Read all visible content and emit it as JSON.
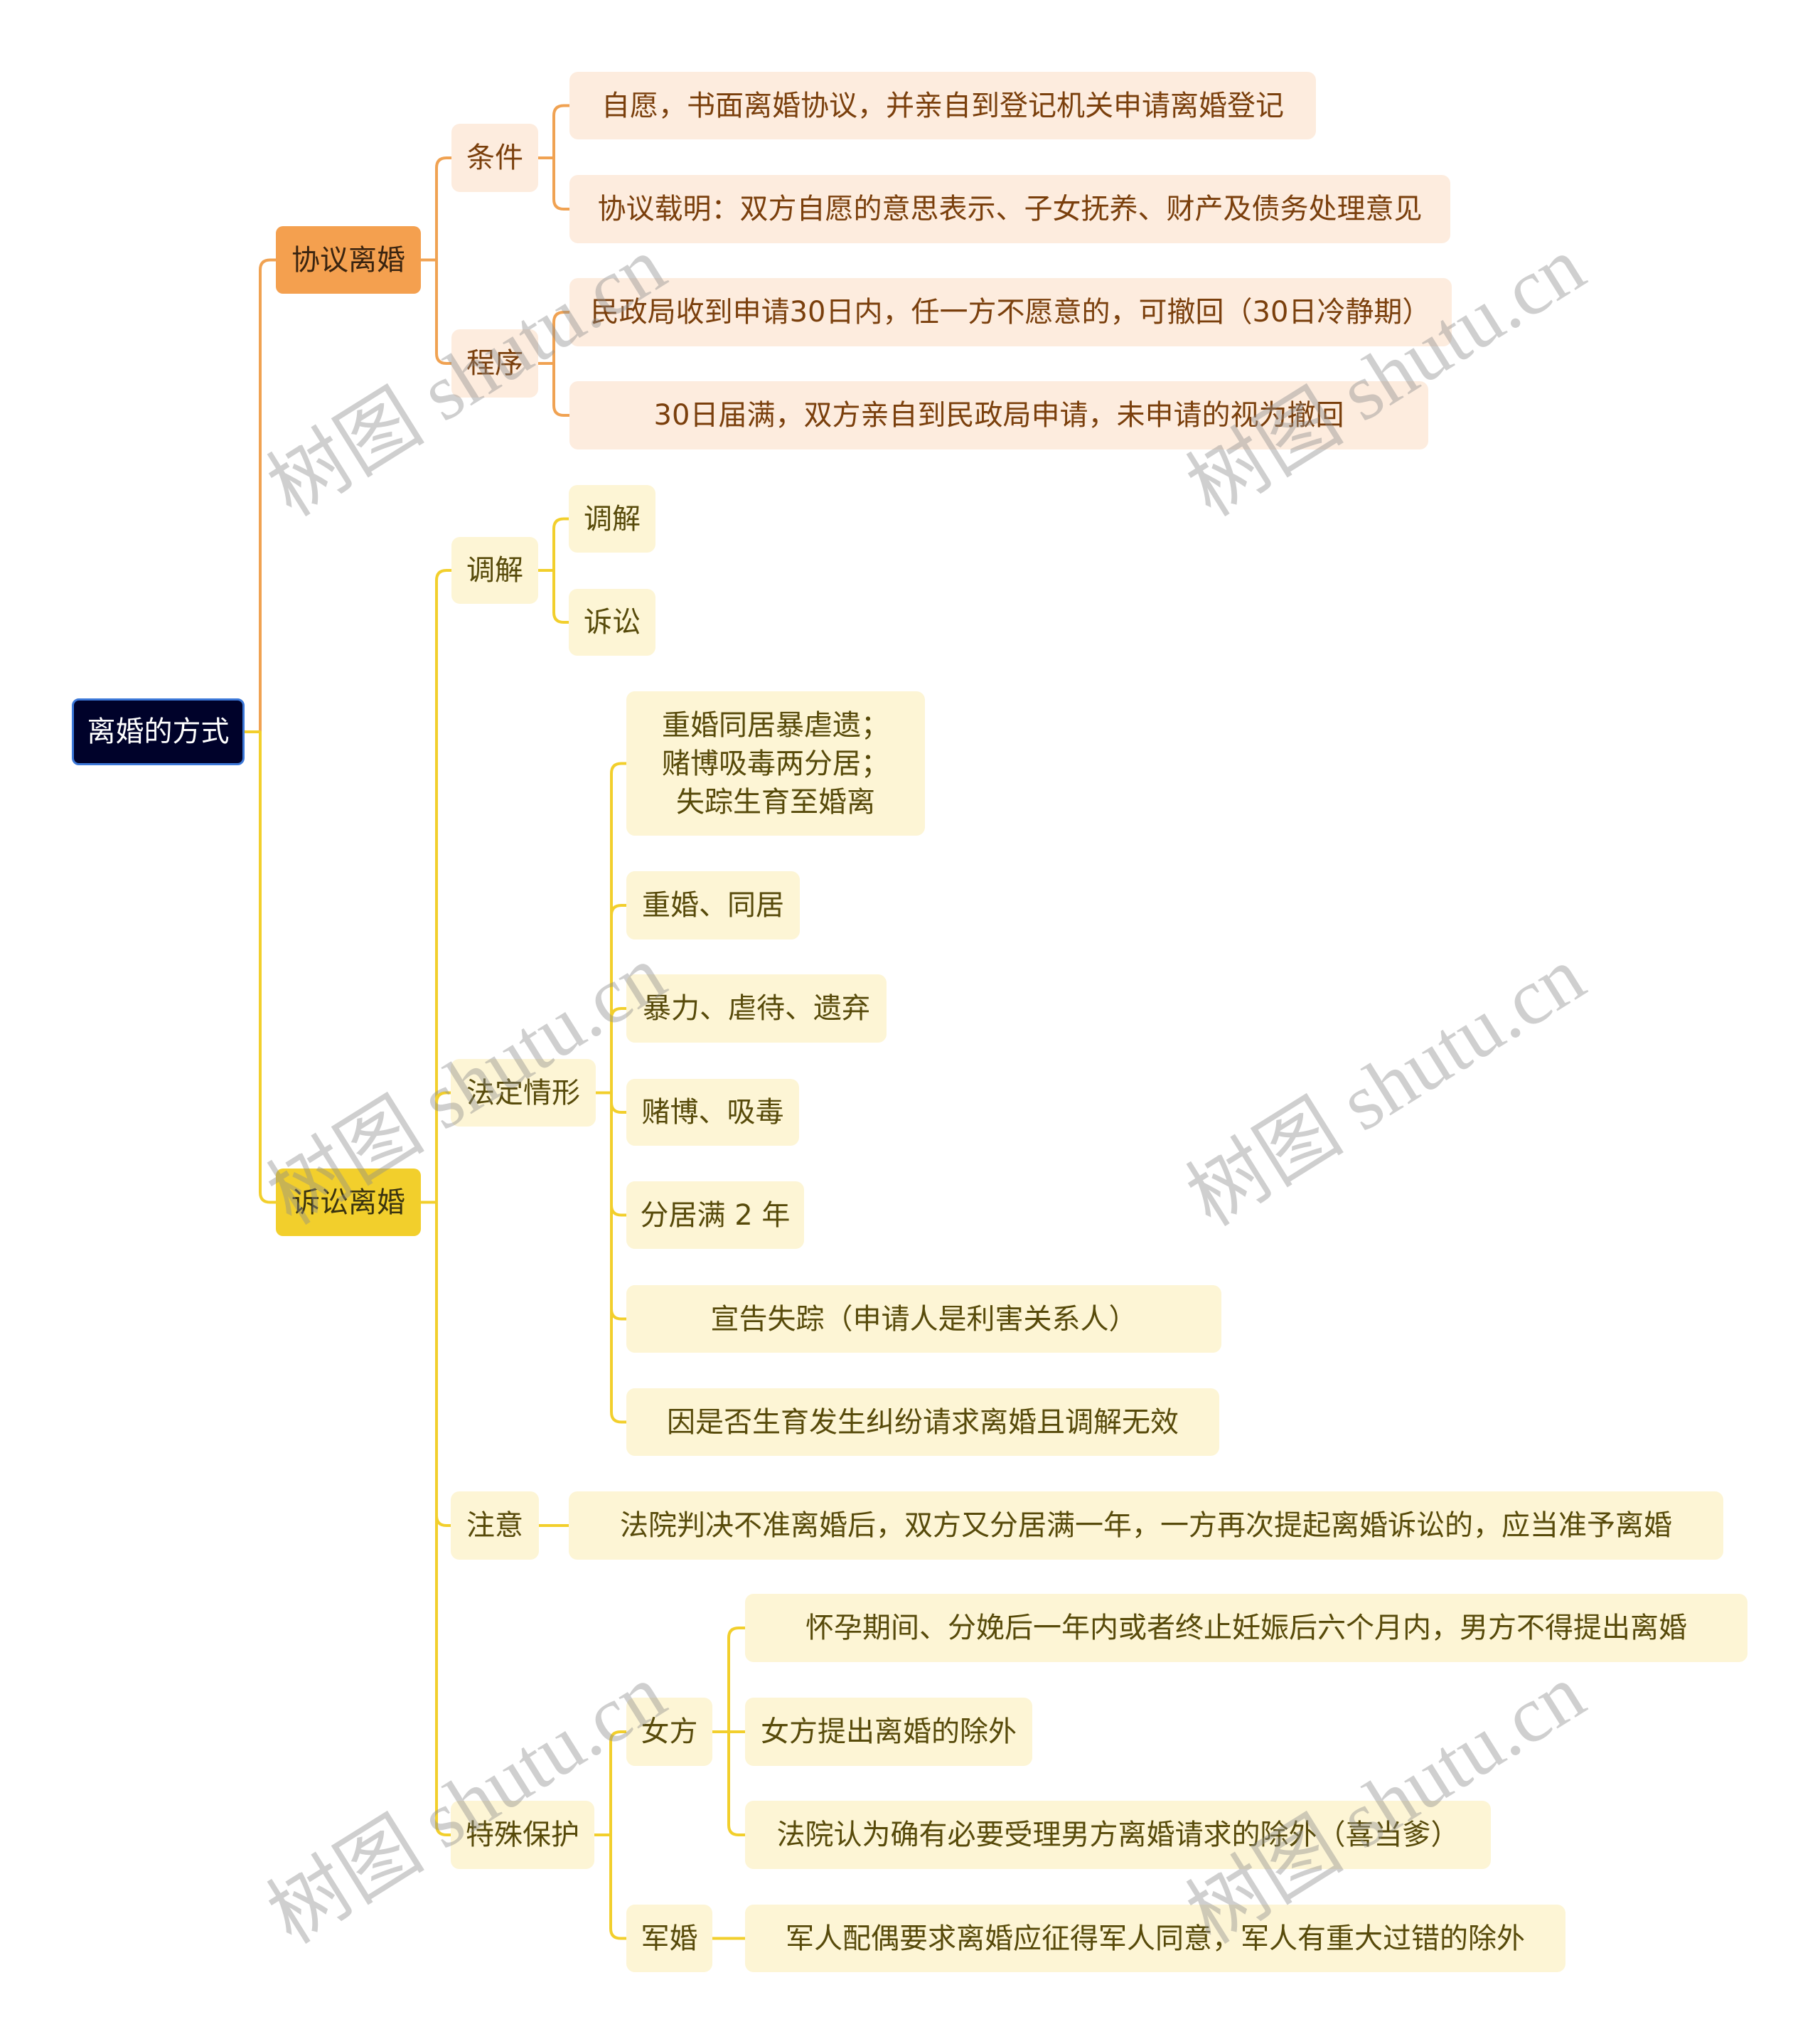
{
  "title": "离婚的方式",
  "watermark": "树图 shutu.cn",
  "colors": {
    "root_fill": "#00022a",
    "root_border": "#3c78d8",
    "root_text": "#ffffff",
    "a_main": "#f4a04f",
    "a_main_text": "#3a2410",
    "a_sub": "#fdecde",
    "a_text": "#7a3f0c",
    "a_line": "#f0a252",
    "b_main": "#f2cf2c",
    "b_main_text": "#3a3310",
    "b_sub": "#fdf5d5",
    "b_text": "#574a0a",
    "b_line": "#f2cf2c"
  },
  "root": {
    "label": "离婚的方式"
  },
  "branches": [
    {
      "label": "协议离婚",
      "children": [
        {
          "label": "条件",
          "children": [
            {
              "label": "自愿，书面离婚协议，并亲自到登记机关申请离婚登记"
            },
            {
              "label": "协议载明：双方自愿的意思表示、子女抚养、财产及债务处理意见"
            }
          ]
        },
        {
          "label": "程序",
          "children": [
            {
              "label": "民政局收到申请30日内，任一方不愿意的，可撤回（30日冷静期）"
            },
            {
              "label": "30日届满，双方亲自到民政局申请，未申请的视为撤回"
            }
          ]
        }
      ]
    },
    {
      "label": "诉讼离婚",
      "children": [
        {
          "label": "调解",
          "children": [
            {
              "label": "调解"
            },
            {
              "label": "诉讼"
            }
          ]
        },
        {
          "label": "法定情形",
          "children": [
            {
              "label": "重婚同居暴虐遗；\n赌博吸毒两分居；\n失踪生育至婚离"
            },
            {
              "label": "重婚、同居"
            },
            {
              "label": "暴力、虐待、遗弃"
            },
            {
              "label": "赌博、吸毒"
            },
            {
              "label": "分居满 2 年"
            },
            {
              "label": "宣告失踪（申请人是利害关系人）"
            },
            {
              "label": "因是否生育发生纠纷请求离婚且调解无效"
            }
          ]
        },
        {
          "label": "注意",
          "children": [
            {
              "label": "法院判决不准离婚后，双方又分居满一年，一方再次提起离婚诉讼的，应当准予离婚"
            }
          ]
        },
        {
          "label": "特殊保护",
          "children": [
            {
              "label": "女方",
              "children": [
                {
                  "label": "怀孕期间、分娩后一年内或者终止妊娠后六个月内，男方不得提出离婚"
                },
                {
                  "label": "女方提出离婚的除外"
                },
                {
                  "label": "法院认为确有必要受理男方离婚请求的除外（喜当爹）"
                }
              ]
            },
            {
              "label": "军婚",
              "children": [
                {
                  "label": "军人配偶要求离婚应征得军人同意，军人有重大过错的除外"
                }
              ]
            }
          ]
        }
      ]
    }
  ]
}
